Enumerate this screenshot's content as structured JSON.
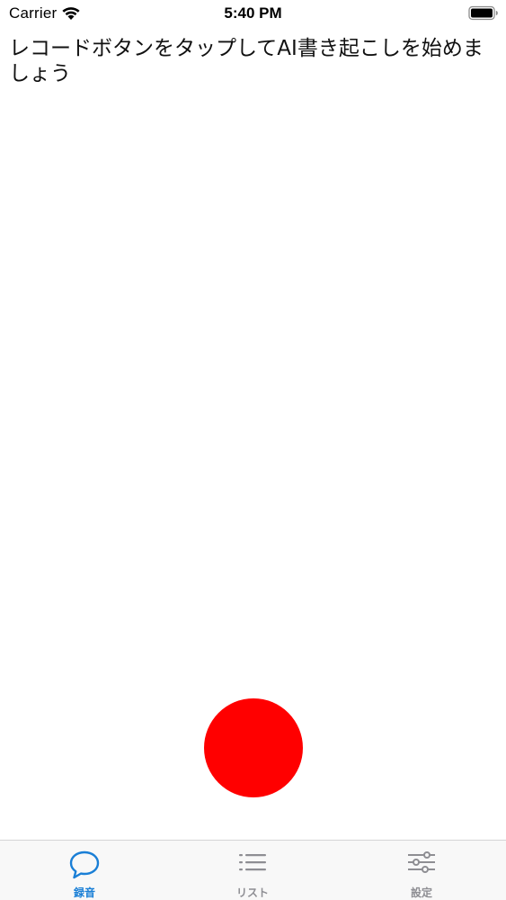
{
  "status_bar": {
    "carrier": "Carrier",
    "time": "5:40 PM"
  },
  "main": {
    "prompt": "レコードボタンをタップしてAI書き起こしを始めましょう"
  },
  "record_button": {
    "color": "#ff0000"
  },
  "tab_bar": {
    "active_color": "#1a7fd6",
    "inactive_color": "#8e8e93",
    "tabs": [
      {
        "label": "録音",
        "icon": "speech-bubble-icon",
        "active": true
      },
      {
        "label": "リスト",
        "icon": "list-icon",
        "active": false
      },
      {
        "label": "設定",
        "icon": "sliders-icon",
        "active": false
      }
    ]
  }
}
